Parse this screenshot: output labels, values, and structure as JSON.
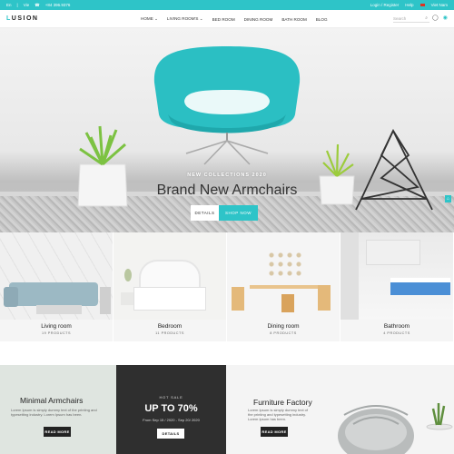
{
  "topbar": {
    "lang": "En",
    "currency": "Vie",
    "phone": "+84 396.9376",
    "login": "Login / Register",
    "help": "Help",
    "country": "Viet Nam"
  },
  "header": {
    "logo_1": "L",
    "logo_2": "USION",
    "nav": [
      "HOME",
      "LIVING ROOM'S",
      "BED ROOM",
      "DINING ROOM",
      "BATH ROOM",
      "BLOG"
    ],
    "search_placeholder": "Search"
  },
  "hero": {
    "subtitle": "NEW COLLECTIONS 2020",
    "title": "Brand New Armchairs",
    "details_label": "DETAILS",
    "shop_label": "SHOP NOW",
    "accent": "#2ec4c8"
  },
  "categories": [
    {
      "name": "Living room",
      "count": "19 PRODUCTS"
    },
    {
      "name": "Bedroom",
      "count": "11 PRODUCTS"
    },
    {
      "name": "Dining room",
      "count": "8 PRODUCTS"
    },
    {
      "name": "Bathroom",
      "count": "4 PRODUCTS"
    }
  ],
  "promos": {
    "p1": {
      "title": "Minimal Armchairs",
      "text_1": "Lorem Ipsum is simply dummy text of the printing and",
      "text_2": "typesetting industry. Lorem Ipsum has been.",
      "button": "READ MORE"
    },
    "p2": {
      "tag": "HOT SALE",
      "title": "UP TO 70%",
      "dates": "From Sep 15 / 2020 - Sep 20/ 2020",
      "button": "DETAILS"
    },
    "p3": {
      "title": "Furniture Factory",
      "text_1": "Lorem Ipsum is simply dummy text of",
      "text_2": "the printing and typesetting industry.",
      "text_3": "Lorem Ipsum has been.",
      "button": "READ MORE"
    }
  }
}
